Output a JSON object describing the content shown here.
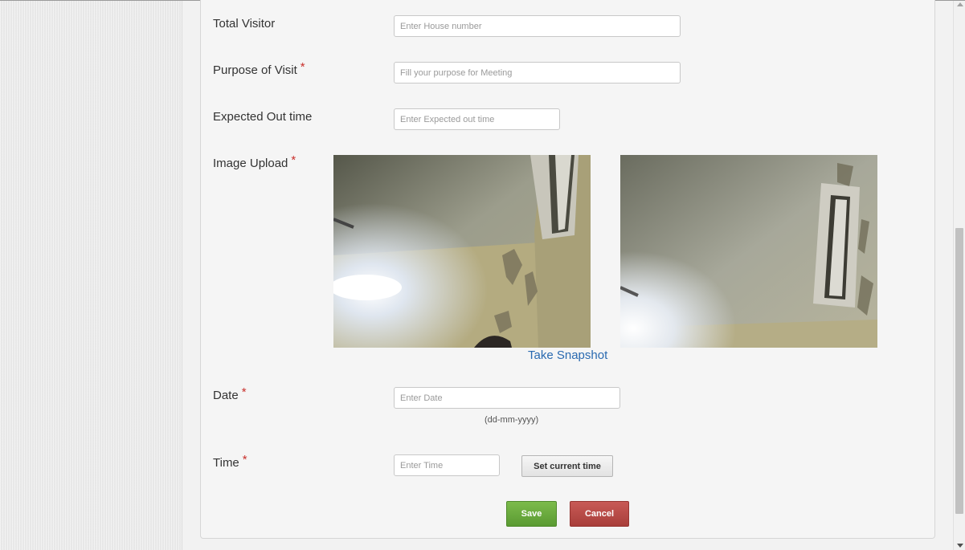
{
  "form": {
    "total_visitor": {
      "label": "Total Visitor",
      "placeholder": "Enter House number"
    },
    "purpose": {
      "label": "Purpose of Visit",
      "required_mark": "*",
      "placeholder": "Fill your purpose for Meeting"
    },
    "out_time": {
      "label": "Expected Out time",
      "placeholder": "Enter Expected out time"
    },
    "image_upload": {
      "label": "Image Upload",
      "required_mark": "*",
      "snapshot_link": "Take Snapshot"
    },
    "date": {
      "label": "Date",
      "required_mark": "*",
      "placeholder": "Enter Date",
      "hint": "(dd-mm-yyyy)"
    },
    "time": {
      "label": "Time",
      "required_mark": "*",
      "placeholder": "Enter Time",
      "set_current_label": "Set current time"
    }
  },
  "actions": {
    "save_label": "Save",
    "cancel_label": "Cancel"
  },
  "colors": {
    "required": "#c9302c",
    "link": "#2a6ab0",
    "save": "#66a33b",
    "cancel": "#b4494a"
  }
}
